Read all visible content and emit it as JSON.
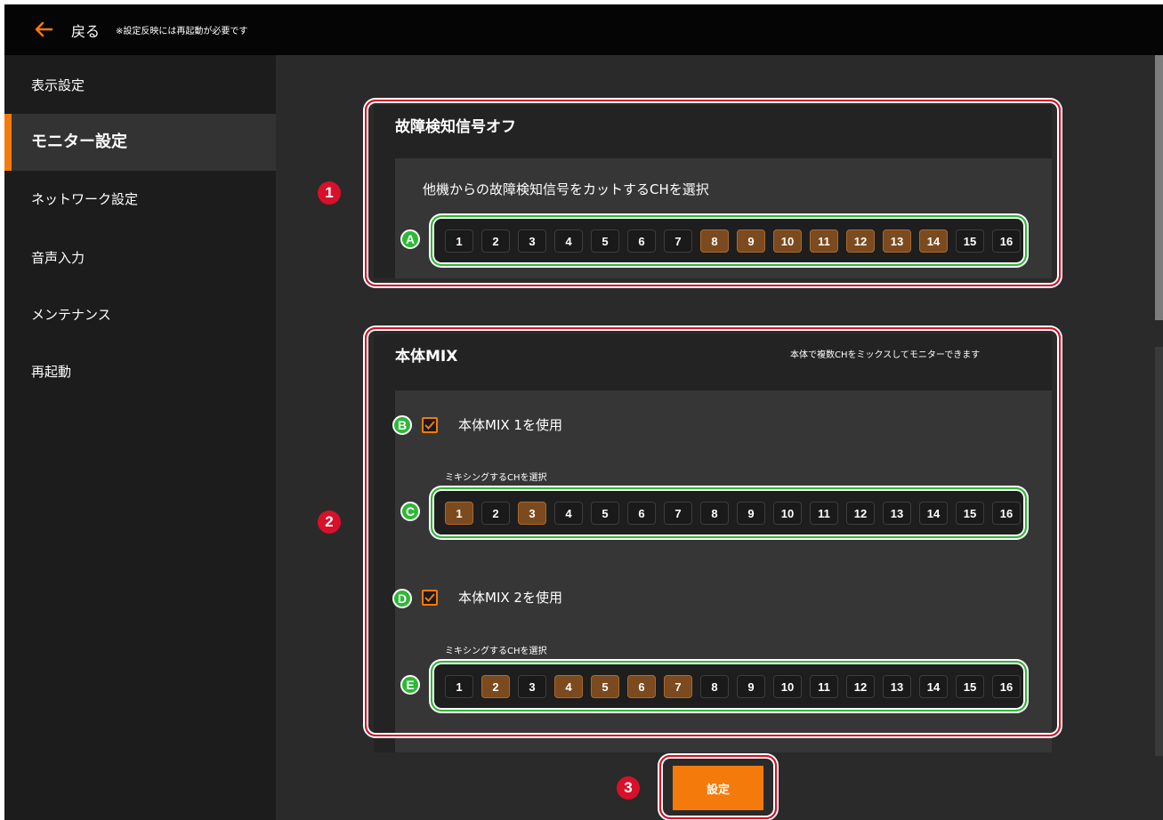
{
  "topbar": {
    "back_label": "戻る",
    "restart_note": "※設定反映には再起動が必要です",
    "accent_color": "#f47a0c"
  },
  "sidebar": {
    "items": [
      {
        "label": "表示設定",
        "active": false
      },
      {
        "label": "モニター設定",
        "active": true
      },
      {
        "label": "ネットワーク設定",
        "active": false
      },
      {
        "label": "音声入力",
        "active": false
      },
      {
        "label": "メンテナンス",
        "active": false
      },
      {
        "label": "再起動",
        "active": false
      }
    ]
  },
  "fault_panel": {
    "title": "故障検知信号オフ",
    "description": "他機からの故障検知信号をカットするCHを選択",
    "channels": [
      "1",
      "2",
      "3",
      "4",
      "5",
      "6",
      "7",
      "8",
      "9",
      "10",
      "11",
      "12",
      "13",
      "14",
      "15",
      "16"
    ],
    "selected": [
      "8",
      "9",
      "10",
      "11",
      "12",
      "13",
      "14"
    ]
  },
  "mix_panel": {
    "title": "本体MIX",
    "note": "本体で複数CHをミックスしてモニターできます",
    "mix1": {
      "checkbox_label": "本体MIX 1を使用",
      "checked": true,
      "select_label": "ミキシングするCHを選択",
      "selected": [
        "1",
        "3"
      ]
    },
    "mix2": {
      "checkbox_label": "本体MIX 2を使用",
      "checked": true,
      "select_label": "ミキシングするCHを選択",
      "selected": [
        "2",
        "4",
        "5",
        "6",
        "7"
      ]
    }
  },
  "settings_button_label": "設定",
  "annotations": {
    "red": [
      "1",
      "2",
      "3"
    ],
    "green": [
      "A",
      "B",
      "C",
      "D",
      "E"
    ]
  }
}
